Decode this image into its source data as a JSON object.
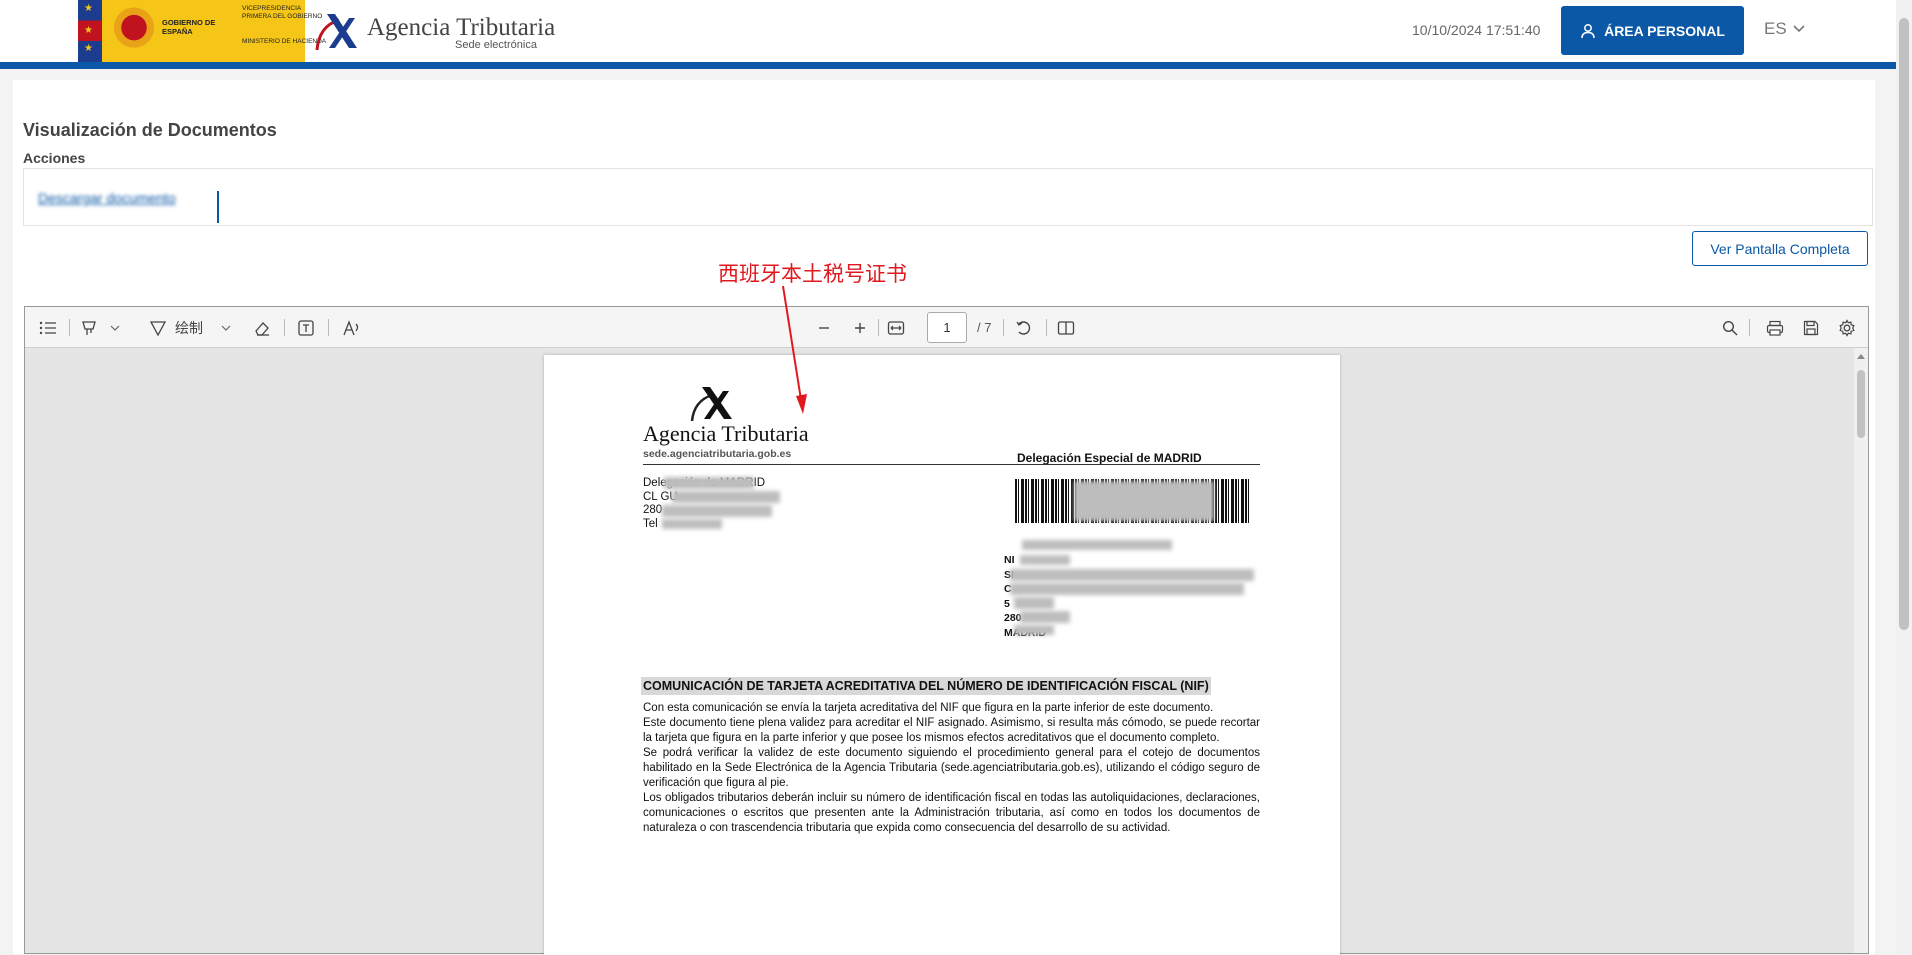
{
  "header": {
    "gov_text_1": "GOBIERNO DE ESPAÑA",
    "gov_text_2": "VICEPRESIDENCIA PRIMERA DEL GOBIERNO",
    "gov_text_3": "MINISTERIO DE HACIENDA",
    "agency_name": "Agencia Tributaria",
    "agency_sub": "Sede electrónica",
    "datetime": "10/10/2024 17:51:40",
    "area_personal_label": "ÁREA PERSONAL",
    "language": "ES",
    "accent_color": "#0b58a6"
  },
  "main": {
    "title": "Visualización de Documentos",
    "acciones_label": "Acciones",
    "acciones_link": "Descargar documento",
    "fullscreen_button": "Ver Pantalla Completa",
    "annotation": "西班牙本土税号证书",
    "annotation_color": "#e0191f"
  },
  "viewer": {
    "toolbar": {
      "draw_label": "绘制",
      "page_current": "1",
      "page_total": "/ 7"
    },
    "icons": [
      "list-icon",
      "highlight-icon",
      "chevron-down-icon",
      "draw-icon",
      "eraser-icon",
      "text-box-icon",
      "read-aloud-icon",
      "zoom-out-icon",
      "zoom-in-icon",
      "fit-width-icon",
      "rotate-icon",
      "page-view-icon",
      "search-icon",
      "print-icon",
      "save-icon",
      "settings-icon"
    ]
  },
  "pdf": {
    "logo_name": "Agencia Tributaria",
    "logo_url": "sede.agenciatributaria.gob.es",
    "delegation": "Delegación Especial de MADRID",
    "address_lines": [
      "Delegación de MADRID",
      "CL GU",
      "280",
      "Tel"
    ],
    "recipient_lines": [
      "NI",
      "SI",
      "",
      "C",
      "5",
      "280",
      "MADRID"
    ],
    "heading": "COMUNICACIÓN DE TARJETA ACREDITATIVA DEL NÚMERO DE IDENTIFICACIÓN FISCAL (NIF)",
    "paragraphs": [
      "Con esta comunicación se envía la tarjeta acreditativa del NIF que figura en la parte inferior de este documento.",
      "Este documento tiene plena validez para acreditar el NIF asignado. Asimismo, si resulta más cómodo, se puede recortar la tarjeta que figura en la parte inferior y que posee los mismos efectos acreditativos que el documento completo.",
      "Se podrá verificar la validez de este documento siguiendo el procedimiento general para el cotejo de documentos habilitado en la Sede Electrónica de la Agencia Tributaria (sede.agenciatributaria.gob.es), utilizando el código seguro de verificación que figura al pie.",
      "Los obligados tributarios deberán incluir su número de identificación fiscal en todas las autoliquidaciones, declaraciones, comunicaciones o escritos que presenten ante la Administración tributaria, así como en todos los documentos de naturaleza o con trascendencia tributaria que expida como consecuencia del desarrollo de su actividad."
    ]
  }
}
